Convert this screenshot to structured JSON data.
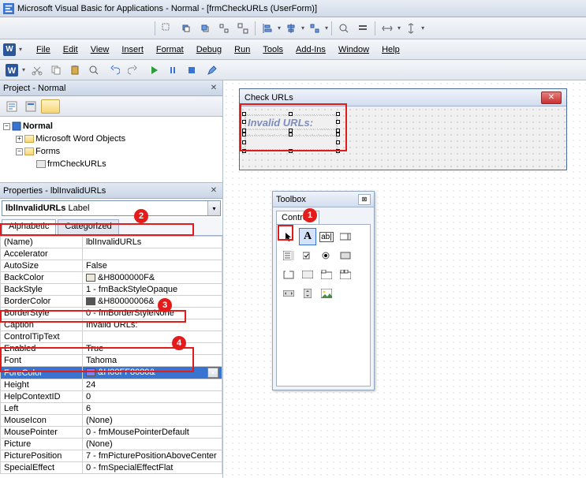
{
  "title": "Microsoft Visual Basic for Applications - Normal - [frmCheckURLs (UserForm)]",
  "menus": [
    "File",
    "Edit",
    "View",
    "Insert",
    "Format",
    "Debug",
    "Run",
    "Tools",
    "Add-Ins",
    "Window",
    "Help"
  ],
  "project_panel_title": "Project - Normal",
  "tree": {
    "root": "Normal",
    "n1": "Microsoft Word Objects",
    "n2": "Forms",
    "n3": "frmCheckURLs"
  },
  "props_panel_title": "Properties - lblInvalidURLs",
  "obj_combo": {
    "name": "lblInvalidURLs",
    "type": "Label"
  },
  "tabs": {
    "a": "Alphabetic",
    "b": "Categorized"
  },
  "props": [
    {
      "k": "(Name)",
      "v": "lblInvalidURLs"
    },
    {
      "k": "Accelerator",
      "v": ""
    },
    {
      "k": "AutoSize",
      "v": "False"
    },
    {
      "k": "BackColor",
      "v": "&H8000000F&",
      "sw": "#ece9d8"
    },
    {
      "k": "BackStyle",
      "v": "1 - fmBackStyleOpaque"
    },
    {
      "k": "BorderColor",
      "v": "&H80000006&",
      "sw": "#555555"
    },
    {
      "k": "BorderStyle",
      "v": "0 - fmBorderStyleNone"
    },
    {
      "k": "Caption",
      "v": "Invalid URLs:"
    },
    {
      "k": "ControlTipText",
      "v": ""
    },
    {
      "k": "Enabled",
      "v": "True"
    },
    {
      "k": "Font",
      "v": "Tahoma"
    },
    {
      "k": "ForeColor",
      "v": "&H00FF8080&",
      "sw": "#8080ff",
      "sel": true,
      "dd": true
    },
    {
      "k": "Height",
      "v": "24"
    },
    {
      "k": "HelpContextID",
      "v": "0"
    },
    {
      "k": "Left",
      "v": "6"
    },
    {
      "k": "MouseIcon",
      "v": "(None)"
    },
    {
      "k": "MousePointer",
      "v": "0 - fmMousePointerDefault"
    },
    {
      "k": "Picture",
      "v": "(None)"
    },
    {
      "k": "PicturePosition",
      "v": "7 - fmPicturePositionAboveCenter"
    },
    {
      "k": "SpecialEffect",
      "v": "0 - fmSpecialEffectFlat"
    }
  ],
  "form": {
    "title": "Check URLs",
    "label_text": "Invalid URLs:"
  },
  "toolbox": {
    "title": "Toolbox",
    "tab": "Controls"
  },
  "badges": {
    "b1": "1",
    "b2": "2",
    "b3": "3",
    "b4": "4"
  }
}
